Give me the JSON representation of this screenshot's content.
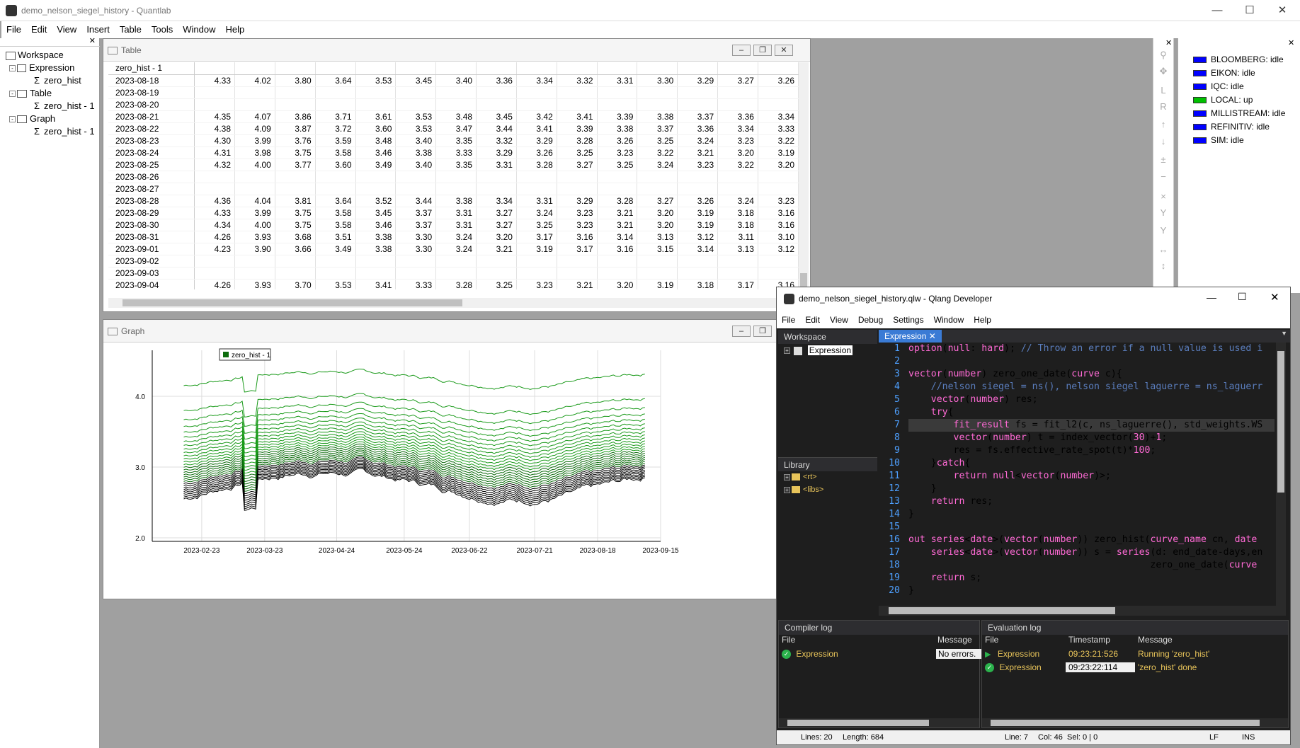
{
  "main_window": {
    "title": "demo_nelson_siegel_history - Quantlab",
    "menu": [
      "File",
      "Edit",
      "View",
      "Insert",
      "Table",
      "Tools",
      "Window",
      "Help"
    ]
  },
  "workspace_tree": {
    "root": "Workspace",
    "items": [
      {
        "label": "Expression",
        "child": "zero_hist"
      },
      {
        "label": "Table",
        "child": "zero_hist - 1"
      },
      {
        "label": "Graph",
        "child": "zero_hist - 1"
      }
    ]
  },
  "table_panel": {
    "title": "Table",
    "header": "zero_hist - 1",
    "rows": [
      {
        "date": "2023-08-18",
        "values": [
          "4.33",
          "4.02",
          "3.80",
          "3.64",
          "3.53",
          "3.45",
          "3.40",
          "3.36",
          "3.34",
          "3.32",
          "3.31",
          "3.30",
          "3.29",
          "3.27",
          "3.26"
        ]
      },
      {
        "date": "2023-08-19",
        "values": []
      },
      {
        "date": "2023-08-20",
        "values": []
      },
      {
        "date": "2023-08-21",
        "values": [
          "4.35",
          "4.07",
          "3.86",
          "3.71",
          "3.61",
          "3.53",
          "3.48",
          "3.45",
          "3.42",
          "3.41",
          "3.39",
          "3.38",
          "3.37",
          "3.36",
          "3.34"
        ]
      },
      {
        "date": "2023-08-22",
        "values": [
          "4.38",
          "4.09",
          "3.87",
          "3.72",
          "3.60",
          "3.53",
          "3.47",
          "3.44",
          "3.41",
          "3.39",
          "3.38",
          "3.37",
          "3.36",
          "3.34",
          "3.33"
        ]
      },
      {
        "date": "2023-08-23",
        "values": [
          "4.30",
          "3.99",
          "3.76",
          "3.59",
          "3.48",
          "3.40",
          "3.35",
          "3.32",
          "3.29",
          "3.28",
          "3.26",
          "3.25",
          "3.24",
          "3.23",
          "3.22"
        ]
      },
      {
        "date": "2023-08-24",
        "values": [
          "4.31",
          "3.98",
          "3.75",
          "3.58",
          "3.46",
          "3.38",
          "3.33",
          "3.29",
          "3.26",
          "3.25",
          "3.23",
          "3.22",
          "3.21",
          "3.20",
          "3.19"
        ]
      },
      {
        "date": "2023-08-25",
        "values": [
          "4.32",
          "4.00",
          "3.77",
          "3.60",
          "3.49",
          "3.40",
          "3.35",
          "3.31",
          "3.28",
          "3.27",
          "3.25",
          "3.24",
          "3.23",
          "3.22",
          "3.20"
        ]
      },
      {
        "date": "2023-08-26",
        "values": []
      },
      {
        "date": "2023-08-27",
        "values": []
      },
      {
        "date": "2023-08-28",
        "values": [
          "4.36",
          "4.04",
          "3.81",
          "3.64",
          "3.52",
          "3.44",
          "3.38",
          "3.34",
          "3.31",
          "3.29",
          "3.28",
          "3.27",
          "3.26",
          "3.24",
          "3.23"
        ]
      },
      {
        "date": "2023-08-29",
        "values": [
          "4.33",
          "3.99",
          "3.75",
          "3.58",
          "3.45",
          "3.37",
          "3.31",
          "3.27",
          "3.24",
          "3.23",
          "3.21",
          "3.20",
          "3.19",
          "3.18",
          "3.16"
        ]
      },
      {
        "date": "2023-08-30",
        "values": [
          "4.34",
          "4.00",
          "3.75",
          "3.58",
          "3.46",
          "3.37",
          "3.31",
          "3.27",
          "3.25",
          "3.23",
          "3.21",
          "3.20",
          "3.19",
          "3.18",
          "3.16"
        ]
      },
      {
        "date": "2023-08-31",
        "values": [
          "4.26",
          "3.93",
          "3.68",
          "3.51",
          "3.38",
          "3.30",
          "3.24",
          "3.20",
          "3.17",
          "3.16",
          "3.14",
          "3.13",
          "3.12",
          "3.11",
          "3.10"
        ]
      },
      {
        "date": "2023-09-01",
        "values": [
          "4.23",
          "3.90",
          "3.66",
          "3.49",
          "3.38",
          "3.30",
          "3.24",
          "3.21",
          "3.19",
          "3.17",
          "3.16",
          "3.15",
          "3.14",
          "3.13",
          "3.12"
        ]
      },
      {
        "date": "2023-09-02",
        "values": []
      },
      {
        "date": "2023-09-03",
        "values": []
      },
      {
        "date": "2023-09-04",
        "values": [
          "4.26",
          "3.93",
          "3.70",
          "3.53",
          "3.41",
          "3.33",
          "3.28",
          "3.25",
          "3.23",
          "3.21",
          "3.20",
          "3.19",
          "3.18",
          "3.17",
          "3.16"
        ]
      }
    ]
  },
  "graph_panel": {
    "title": "Graph",
    "legend": "zero_hist - 1",
    "y_ticks": [
      "4.0",
      "3.0",
      "2.0"
    ],
    "x_ticks": [
      "2023-02-23",
      "2023-03-23",
      "2023-04-24",
      "2023-05-24",
      "2023-06-22",
      "2023-07-21",
      "2023-08-18",
      "2023-09-15"
    ]
  },
  "chart_data": {
    "type": "line",
    "title": "",
    "legend": [
      "zero_hist - 1"
    ],
    "xlabel": "",
    "ylabel": "",
    "x_range": [
      "2023-02-01",
      "2023-09-15"
    ],
    "ylim": [
      1.95,
      4.65
    ],
    "series_count": 30,
    "note_colors": [
      "#008000",
      "#000000"
    ]
  },
  "data_sources": [
    {
      "name": "BLOOMBERG: idle",
      "color": "#0000ff"
    },
    {
      "name": "EIKON: idle",
      "color": "#0000ff"
    },
    {
      "name": "IQC: idle",
      "color": "#0000ff"
    },
    {
      "name": "LOCAL: up",
      "color": "#00c000"
    },
    {
      "name": "MILLISTREAM: idle",
      "color": "#0000ff"
    },
    {
      "name": "REFINITIV: idle",
      "color": "#0000ff"
    },
    {
      "name": "SIM: idle",
      "color": "#0000ff"
    }
  ],
  "dev_window": {
    "title": "demo_nelson_siegel_history.qlw - Qlang Developer",
    "menu": [
      "File",
      "Edit",
      "View",
      "Debug",
      "Settings",
      "Window",
      "Help"
    ],
    "workspace_label": "Workspace",
    "workspace_item": "Expression",
    "library_label": "Library",
    "library_items": [
      "<rt>",
      "<libs>"
    ],
    "tab": "Expression",
    "code_lines": [
      "option(null: hard); // Throw an error if a null value is used i",
      "",
      "vector(number) zero_one_date(curve c){",
      "    //nelson siegel = ns(), nelson siegel laguerre = ns_laguerr",
      "    vector(number) res;",
      "    try{",
      "        fit_result fs = fit_l2(c, ns_laguerre(), std_weights.WS",
      "        vector(number) t = index_vector(30)+1;",
      "        res = fs.effective_rate_spot(t)*100;",
      "    }catch{",
      "        return null<vector(number)>;",
      "    }",
      "    return res;",
      "}",
      "",
      "out series<date>(vector(number)) zero_hist(curve_name cn, date",
      "    series<date>(vector(number)) s = series(d: end_date-days,en",
      "                                           zero_one_date(curve",
      "    return s;",
      "}"
    ],
    "compiler_log": {
      "title": "Compiler log",
      "col_file": "File",
      "col_message": "Message",
      "row": {
        "file": "Expression",
        "message": "No errors."
      }
    },
    "evaluation_log": {
      "title": "Evaluation log",
      "col_file": "File",
      "col_timestamp": "Timestamp",
      "col_message": "Message",
      "rows": [
        {
          "file": "Expression",
          "timestamp": "09:23:21:526",
          "message": "Running 'zero_hist'"
        },
        {
          "file": "Expression",
          "timestamp": "09:23:22:114",
          "message": "'zero_hist' done"
        }
      ]
    },
    "status": {
      "lines": "Lines: 20",
      "length": "Length: 684",
      "line": "Line: 7",
      "col": "Col: 46",
      "sel": "Sel: 0 | 0",
      "eol": "LF",
      "mode": "INS"
    }
  }
}
